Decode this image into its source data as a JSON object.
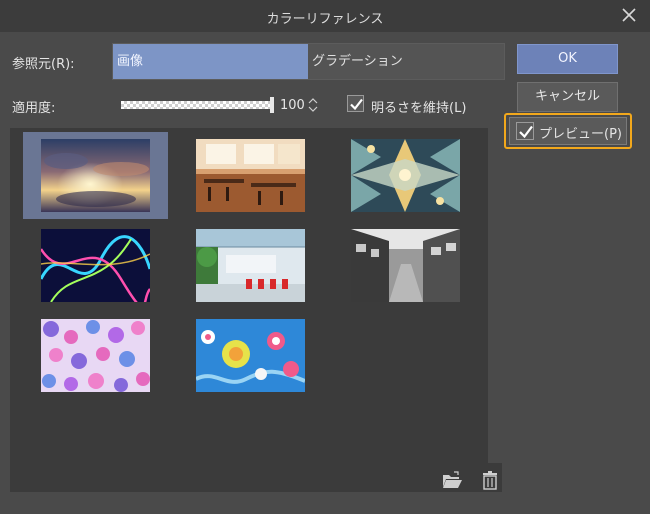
{
  "window": {
    "title": "カラーリファレンス"
  },
  "reference": {
    "label": "参照元(R):",
    "options": [
      "画像",
      "グラデーション"
    ],
    "selected": "画像"
  },
  "opacity": {
    "label": "適用度:",
    "value": "100",
    "level_percent": 100
  },
  "keep_brightness": {
    "label": "明るさを維持(L)",
    "checked": true
  },
  "buttons": {
    "ok": "OK",
    "cancel": "キャンセル"
  },
  "preview": {
    "label": "プレビュー(P)",
    "checked": true,
    "highlight_color": "#f2a81c"
  },
  "thumbnails": [
    {
      "name": "sunset-clouds",
      "selected": true
    },
    {
      "name": "cafe-interior",
      "selected": false
    },
    {
      "name": "kaleidoscope-pattern",
      "selected": false
    },
    {
      "name": "neon-swirls",
      "selected": false
    },
    {
      "name": "modern-lobby",
      "selected": false
    },
    {
      "name": "monochrome-street",
      "selected": false
    },
    {
      "name": "watercolor-dots",
      "selected": false
    },
    {
      "name": "japanese-floral-pattern",
      "selected": false
    }
  ],
  "colors": {
    "accent": "#7d95c6",
    "ok_button": "#6d82b8",
    "selection": "#6a7694"
  },
  "icons": [
    "close-icon",
    "spinner-icon",
    "check-icon",
    "open-folder-icon",
    "trash-icon"
  ]
}
